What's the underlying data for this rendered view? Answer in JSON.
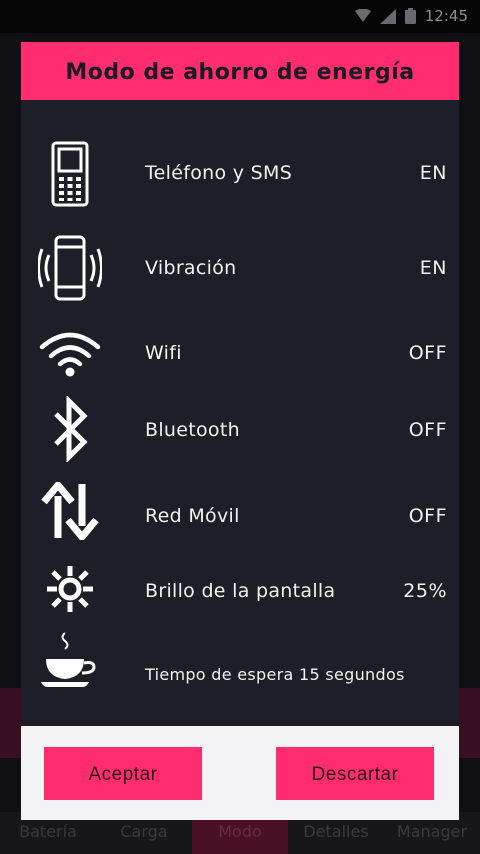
{
  "status_bar": {
    "time": "12:45"
  },
  "dialog": {
    "title": "Modo de ahorro de energía",
    "settings": [
      {
        "label": "Teléfono y SMS",
        "value": "EN",
        "icon": "phone-keypad-icon"
      },
      {
        "label": "Vibración",
        "value": "EN",
        "icon": "vibration-icon"
      },
      {
        "label": "Wifi",
        "value": "OFF",
        "icon": "wifi-icon"
      },
      {
        "label": "Bluetooth",
        "value": "OFF",
        "icon": "bluetooth-icon"
      },
      {
        "label": "Red Móvil",
        "value": "OFF",
        "icon": "mobile-data-icon"
      },
      {
        "label": "Brillo de la pantalla",
        "value": "25%",
        "icon": "brightness-icon"
      },
      {
        "label": "Tiempo de espera 15 segundos",
        "icon": "coffee-cup-icon"
      }
    ],
    "accept_label": "Aceptar",
    "discard_label": "Descartar"
  },
  "bottom_nav": {
    "items": [
      {
        "label": "Batería"
      },
      {
        "label": "Carga"
      },
      {
        "label": "Modo"
      },
      {
        "label": "Detalles"
      },
      {
        "label": "Manager"
      }
    ],
    "active_index": 2
  },
  "colors": {
    "accent": "#ff2c6f",
    "dialog_bg": "#1d1e27",
    "footer_bg": "#f3f3f5"
  }
}
